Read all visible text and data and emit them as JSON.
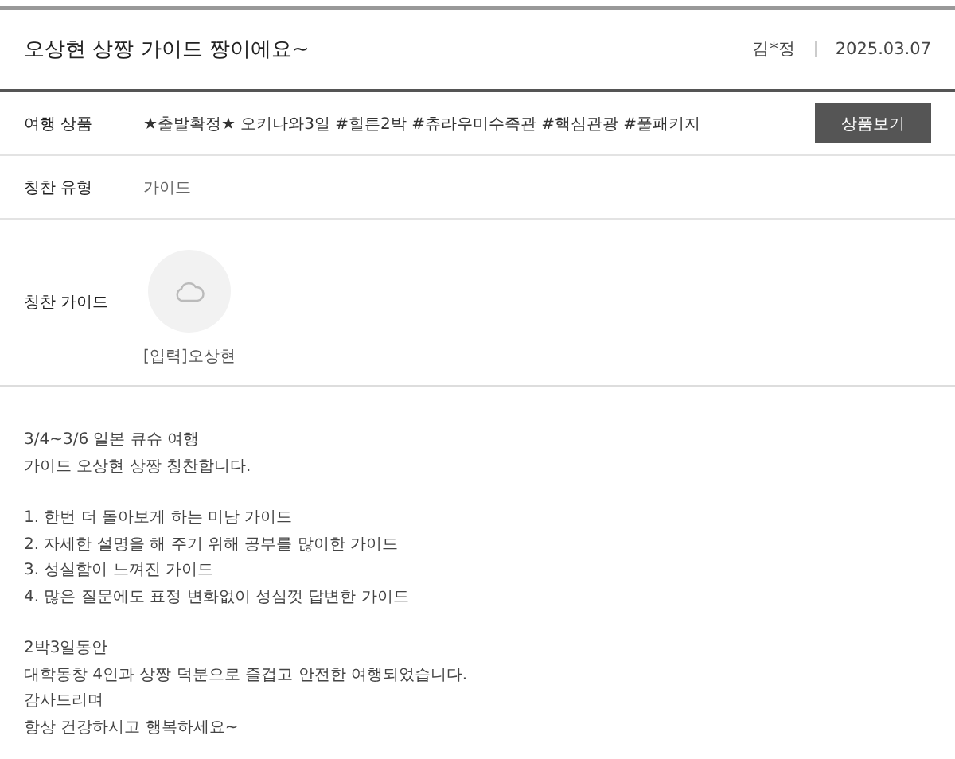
{
  "review": {
    "title": "오상현 상짱 가이드 짱이에요~",
    "author": "김*정",
    "date": "2025.03.07"
  },
  "fields": [
    {
      "kind": "product",
      "label": "여행 상품",
      "value": "★출발확정★ 오키나와3일 #힐튼2박 #츄라우미수족관 #핵심관광 #풀패키지",
      "button": "상품보기"
    },
    {
      "kind": "text",
      "label": "칭찬 유형",
      "value": "가이드"
    },
    {
      "kind": "guide",
      "label": "칭찬 가이드",
      "value": "[입력]오상현"
    }
  ],
  "body": [
    [
      "3/4~3/6 일본 큐슈 여행",
      "가이드 오상현 상짱 칭찬합니다."
    ],
    [
      "1. 한번 더 돌아보게 하는 미남 가이드",
      "2. 자세한 설명을 해 주기 위해 공부를 많이한 가이드",
      "3. 성실함이 느껴진 가이드",
      "4. 많은 질문에도 표정 변화없이 성심껏 답변한 가이드"
    ],
    [
      "2박3일동안",
      "대학동창 4인과 상짱 덕분으로 즐겁고 안전한 여행되었습니다.",
      "감사드리며",
      "항상 건강하시고 행복하세요~"
    ]
  ]
}
